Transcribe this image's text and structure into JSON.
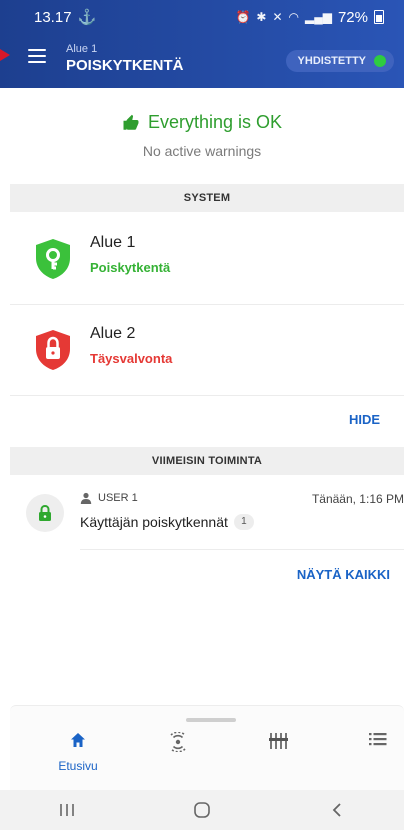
{
  "status_bar": {
    "time": "13.17",
    "battery": "72%"
  },
  "header": {
    "area_name": "Alue 1",
    "title": "POISKYTKENTÄ",
    "connection_label": "YHDISTETTY"
  },
  "status": {
    "title": "Everything is OK",
    "subtitle": "No active warnings"
  },
  "system": {
    "section_label": "SYSTEM",
    "areas": [
      {
        "name": "Alue 1",
        "state": "Poiskytkentä",
        "color": "#35b235"
      },
      {
        "name": "Alue 2",
        "state": "Täysvalvonta",
        "color": "#e53935"
      }
    ],
    "hide_label": "HIDE"
  },
  "recent": {
    "section_label": "VIIMEISIN TOIMINTA",
    "items": [
      {
        "user": "USER 1",
        "time": "Tänään, 1:16 PM",
        "text": "Käyttäjän poiskytkennät",
        "count": "1"
      }
    ],
    "show_all_label": "NÄYTÄ KAIKKI"
  },
  "bottom_nav": {
    "home_label": "Etusivu"
  },
  "colors": {
    "header": "#1d3f8f",
    "accent": "#1a63c6",
    "ok": "#2f9e2f",
    "alarm": "#e53935"
  }
}
